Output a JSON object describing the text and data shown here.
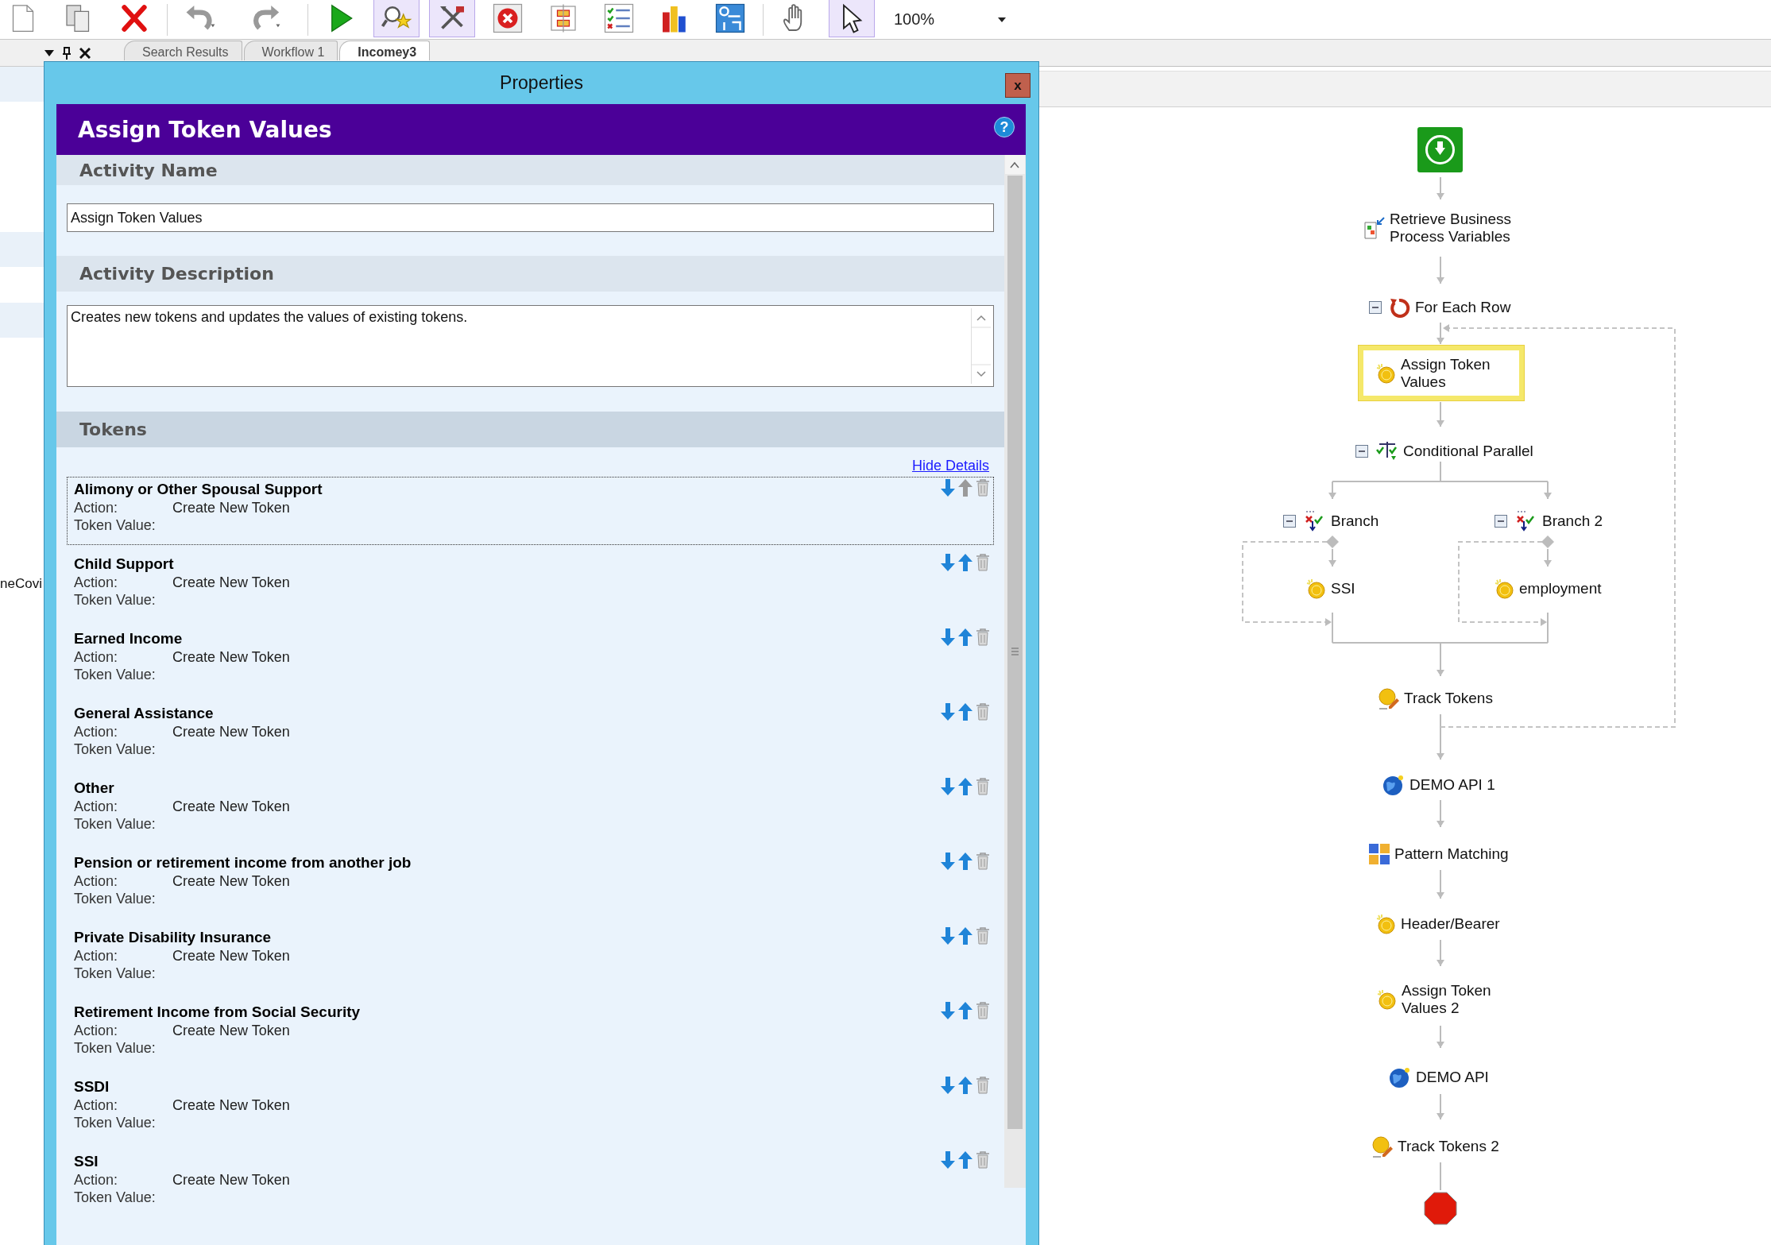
{
  "toolbar": {
    "buttons": [
      {
        "pressed": false
      },
      {
        "pressed": false
      },
      {
        "pressed": false
      },
      {
        "pressed": false
      },
      {
        "pressed": false
      },
      {
        "pressed": false
      },
      {
        "pressed": true
      },
      {
        "pressed": true
      },
      {
        "pressed": false
      },
      {
        "pressed": false
      },
      {
        "pressed": false
      },
      {
        "pressed": false
      },
      {
        "pressed": false
      },
      {
        "pressed": false
      },
      {
        "pressed": true
      }
    ],
    "zoom": "100%"
  },
  "side_panel": {
    "row_text": "neCovi"
  },
  "tabs": [
    {
      "label": "Search Results",
      "selected": false
    },
    {
      "label": "Workflow 1",
      "selected": false
    },
    {
      "label": "Incomey3",
      "selected": true
    }
  ],
  "dialog": {
    "title": "Properties",
    "close": "x",
    "heading": "Assign Token Values",
    "help": "?",
    "activity_name": {
      "label": "Activity Name",
      "value": "Assign Token Values"
    },
    "activity_description": {
      "label": "Activity Description",
      "value": "Creates new tokens and updates the values of existing tokens."
    },
    "tokens": {
      "label": "Tokens",
      "link": "Hide Details",
      "items": [
        {
          "name": "Alimony or Other Spousal Support",
          "action_label": "Action:",
          "action": "Create New Token",
          "value_label": "Token Value:",
          "selected": true,
          "can_move_up": false
        },
        {
          "name": "Child Support",
          "action_label": "Action:",
          "action": "Create New Token",
          "value_label": "Token Value:",
          "selected": false,
          "can_move_up": true
        },
        {
          "name": "Earned Income",
          "action_label": "Action:",
          "action": "Create New Token",
          "value_label": "Token Value:",
          "selected": false,
          "can_move_up": true
        },
        {
          "name": "General Assistance",
          "action_label": "Action:",
          "action": "Create New Token",
          "value_label": "Token Value:",
          "selected": false,
          "can_move_up": true
        },
        {
          "name": "Other",
          "action_label": "Action:",
          "action": "Create New Token",
          "value_label": "Token Value:",
          "selected": false,
          "can_move_up": true
        },
        {
          "name": "Pension or retirement income from another job",
          "action_label": "Action:",
          "action": "Create New Token",
          "value_label": "Token Value:",
          "selected": false,
          "can_move_up": true
        },
        {
          "name": "Private Disability Insurance",
          "action_label": "Action:",
          "action": "Create New Token",
          "value_label": "Token Value:",
          "selected": false,
          "can_move_up": true
        },
        {
          "name": "Retirement Income from Social Security",
          "action_label": "Action:",
          "action": "Create New Token",
          "value_label": "Token Value:",
          "selected": false,
          "can_move_up": true
        },
        {
          "name": "SSDI",
          "action_label": "Action:",
          "action": "Create New Token",
          "value_label": "Token Value:",
          "selected": false,
          "can_move_up": true
        },
        {
          "name": "SSI",
          "action_label": "Action:",
          "action": "Create New Token",
          "value_label": "Token Value:",
          "selected": false,
          "can_move_up": true
        }
      ]
    }
  },
  "workflow": {
    "nodes": [
      {
        "kind": "start",
        "selected": false
      },
      {
        "kind": "retrieve",
        "label": "Retrieve Business\nProcess Variables",
        "selected": false
      },
      {
        "kind": "loop",
        "label": "For Each Row",
        "expanded": true,
        "selected": false
      },
      {
        "kind": "assign",
        "label": "Assign Token\nValues",
        "selected": true
      },
      {
        "kind": "parallel",
        "label": "Conditional Parallel",
        "expanded": true,
        "selected": false
      },
      {
        "kind": "branch",
        "label": "Branch",
        "expanded": true,
        "selected": false
      },
      {
        "kind": "branch",
        "label": "Branch 2",
        "expanded": true,
        "selected": false
      },
      {
        "kind": "assign",
        "label": "SSI",
        "selected": false
      },
      {
        "kind": "assign",
        "label": "employment",
        "selected": false
      },
      {
        "kind": "track",
        "label": "Track Tokens",
        "selected": false
      },
      {
        "kind": "api",
        "label": "DEMO API 1",
        "selected": false
      },
      {
        "kind": "pattern",
        "label": "Pattern Matching",
        "selected": false
      },
      {
        "kind": "assign",
        "label": "Header/Bearer",
        "selected": false
      },
      {
        "kind": "assign",
        "label": "Assign Token\nValues 2",
        "selected": false
      },
      {
        "kind": "api",
        "label": "DEMO API",
        "selected": false
      },
      {
        "kind": "track",
        "label": "Track Tokens 2",
        "selected": false
      },
      {
        "kind": "end",
        "selected": false
      }
    ]
  }
}
